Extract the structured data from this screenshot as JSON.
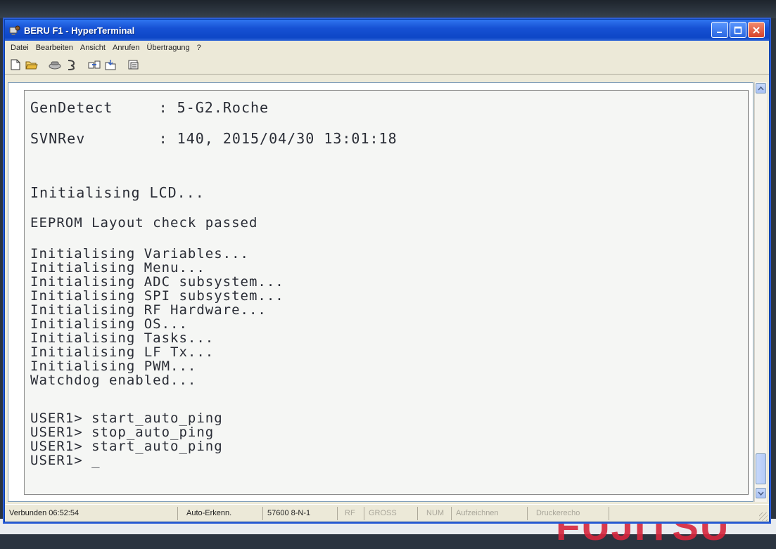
{
  "window": {
    "title": "BERU F1 - HyperTerminal",
    "app_icon": "hyperterminal-icon",
    "controls": [
      "minimize-icon",
      "maximize-icon",
      "close-icon"
    ],
    "title_color": "#1651d4"
  },
  "menu": {
    "items": [
      "Datei",
      "Bearbeiten",
      "Ansicht",
      "Anrufen",
      "Übertragung",
      "?"
    ]
  },
  "toolbar": {
    "icons": [
      "new-icon",
      "open-icon",
      "disconnect-icon",
      "call-icon",
      "send-icon",
      "receive-icon",
      "properties-icon"
    ]
  },
  "terminal": {
    "lines": [
      "GenDetect     : 5-G2.Roche",
      "SVNRev        : 140, 2015/04/30 13:01:18",
      "Initialising LCD...",
      "EEPROM Layout check passed",
      "Initialising Variables...",
      "Initialising Menu...",
      "Initialising ADC subsystem...",
      "Initialising SPI subsystem...",
      "Initialising RF Hardware...",
      "Initialising OS...",
      "Initialising Tasks...",
      "Initialising LF Tx...",
      "Initialising PWM...",
      "Watchdog enabled...",
      "USER1> start_auto_ping",
      "USER1> stop_auto_ping",
      "USER1> start_auto_ping",
      "USER1> _"
    ]
  },
  "status": {
    "connected": "Verbunden 06:52:54",
    "detect": "Auto-Erkenn.",
    "settings": "57600 8-N-1",
    "rf": "RF",
    "gross": "GROSS",
    "num": "NUM",
    "record": "Aufzeichnen",
    "echo": "Druckerecho"
  },
  "background": {
    "poster_text": "FUJITSU"
  }
}
